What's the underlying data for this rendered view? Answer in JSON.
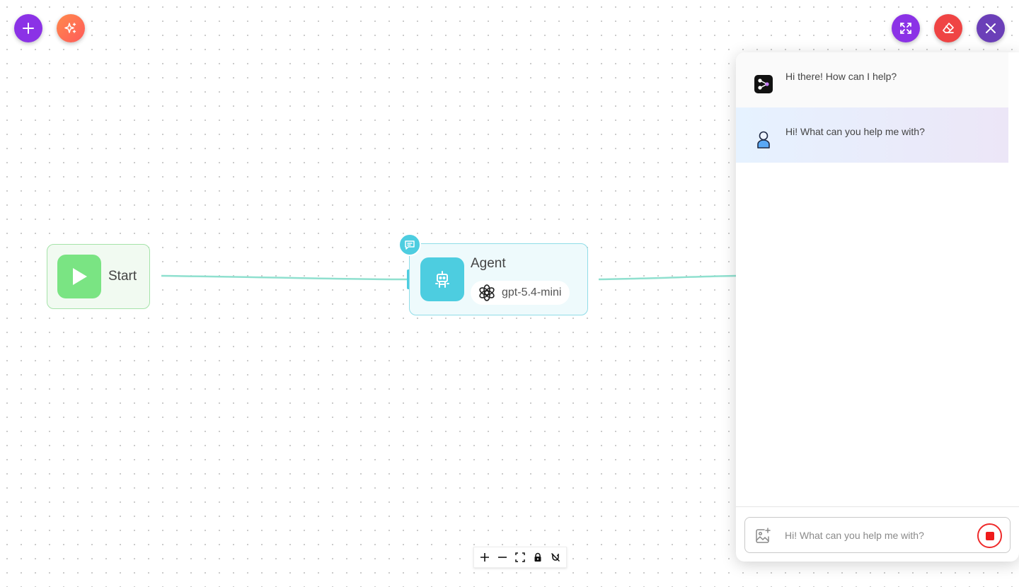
{
  "toolbar": {
    "add_node_icon": "plus-icon",
    "generate_icon": "sparkles-icon",
    "expand_icon": "expand-icon",
    "clear_chat_icon": "eraser-icon",
    "close_chat_icon": "close-icon"
  },
  "colors": {
    "purple": "#8b32e6",
    "orange": "#ff6b4a",
    "red": "#ef4444",
    "dark_purple": "#6b3fb8",
    "edge": "#8fe0cf",
    "start_green": "#7ae483",
    "agent_cyan": "#4dcde0"
  },
  "nodes": {
    "start": {
      "label": "Start",
      "icon": "play-icon"
    },
    "agent": {
      "title": "Agent",
      "model": "gpt-5.4-mini",
      "icon": "robot-icon",
      "model_icon": "openai-icon"
    }
  },
  "canvas_controls": [
    "zoom-in-icon",
    "zoom-out-icon",
    "fit-view-icon",
    "lock-icon",
    "magnet-off-icon"
  ],
  "chat": {
    "messages": [
      {
        "role": "bot",
        "text": "Hi there! How can I help?"
      },
      {
        "role": "user",
        "text": "Hi! What can you help me with?"
      }
    ],
    "input": {
      "placeholder": "Hi! What can you help me with?",
      "value": ""
    }
  }
}
